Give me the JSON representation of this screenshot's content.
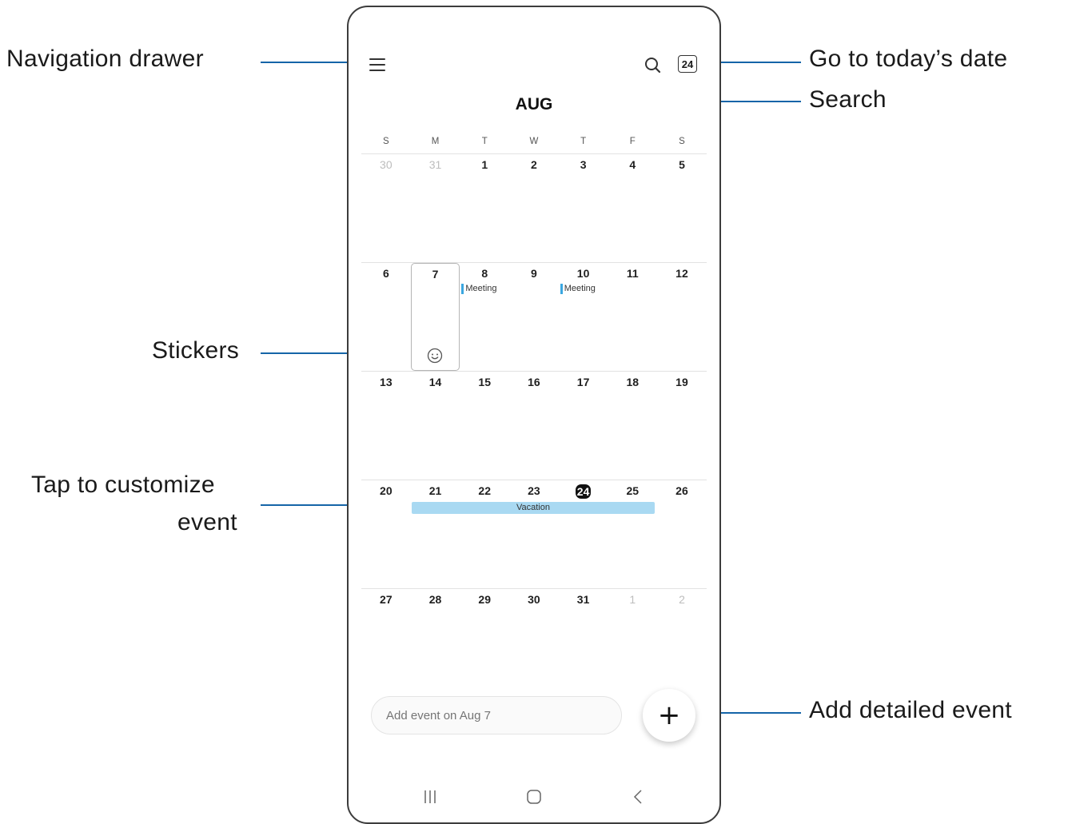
{
  "callouts": {
    "navigation_drawer": "Navigation drawer",
    "stickers": "Stickers",
    "customize_line1": "Tap to customize",
    "customize_line2": "event",
    "today": "Go to today’s date",
    "search": "Search",
    "add_detailed": "Add detailed event"
  },
  "header": {
    "month": "AUG",
    "today_badge": "24"
  },
  "weekdays": [
    "S",
    "M",
    "T",
    "W",
    "T",
    "F",
    "S"
  ],
  "weeks": [
    [
      "30",
      "31",
      "1",
      "2",
      "3",
      "4",
      "5"
    ],
    [
      "6",
      "7",
      "8",
      "9",
      "10",
      "11",
      "12"
    ],
    [
      "13",
      "14",
      "15",
      "16",
      "17",
      "18",
      "19"
    ],
    [
      "20",
      "21",
      "22",
      "23",
      "24",
      "25",
      "26"
    ],
    [
      "27",
      "28",
      "29",
      "30",
      "31",
      "1",
      "2"
    ]
  ],
  "events": {
    "meeting_1": "Meeting",
    "meeting_2": "Meeting",
    "vacation": "Vacation"
  },
  "add_event": {
    "placeholder": "Add event on Aug 7"
  },
  "fab_label": "+",
  "colors": {
    "callout_line": "#1565a8",
    "vacation_bar": "#a9d9f2",
    "meeting_marker": "#3ba7e0",
    "today_highlight": "#111111"
  }
}
